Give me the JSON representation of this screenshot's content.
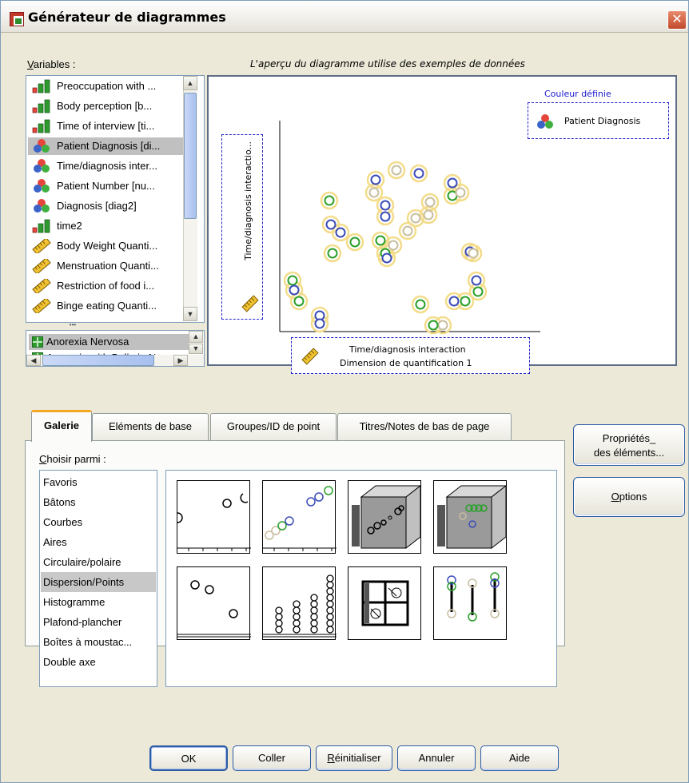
{
  "window": {
    "title": "Générateur de diagrammes",
    "close_glyph": "✕"
  },
  "variables": {
    "label": "Variables :",
    "items": [
      {
        "label": "Preoccupation with ...",
        "icon": "bar-ordinal-icon"
      },
      {
        "label": "Body perception [b...",
        "icon": "bar-ordinal-icon"
      },
      {
        "label": "Time of interview [ti...",
        "icon": "bar-ordinal-icon"
      },
      {
        "label": "Patient Diagnosis [di...",
        "icon": "nominal-icon",
        "selected": true
      },
      {
        "label": "Time/diagnosis inter...",
        "icon": "nominal-icon"
      },
      {
        "label": "Patient Number [nu...",
        "icon": "nominal-icon"
      },
      {
        "label": "Diagnosis [diag2]",
        "icon": "nominal-icon"
      },
      {
        "label": "time2",
        "icon": "bar-ordinal-icon"
      },
      {
        "label": "Body Weight Quanti...",
        "icon": "ruler-scale-icon"
      },
      {
        "label": "Menstruation Quanti...",
        "icon": "ruler-scale-icon"
      },
      {
        "label": "Restriction of food i...",
        "icon": "ruler-scale-icon"
      },
      {
        "label": "Binge eating Quanti...",
        "icon": "ruler-scale-icon"
      }
    ],
    "categories": [
      {
        "label": "Anorexia Nervosa",
        "selected": true
      },
      {
        "label": "Anorexia with Bulimia N..."
      }
    ]
  },
  "preview": {
    "caption": "L'aperçu du diagramme utilise des exemples de données",
    "legend_title": "Couleur définie",
    "legend_variable": "Patient Diagnosis",
    "y_axis_variable": "Time/diagnosis interactio...",
    "x_axis_line1": "Time/diagnosis interaction",
    "x_axis_line2": "Dimension de quantification 1",
    "colors": {
      "green": "#2aa02a",
      "blue": "#3b4cb8",
      "tan": "#c8bea0",
      "ring": "#f3dc8a"
    }
  },
  "tabs": [
    "Galerie",
    "Eléments de base",
    "Groupes/ID de point",
    "Titres/Notes de bas de page"
  ],
  "gallery": {
    "choose_label": "Choisir parmi :",
    "items": [
      "Favoris",
      "Bâtons",
      "Courbes",
      "Aires",
      "Circulaire/polaire",
      "Dispersion/Points",
      "Histogramme",
      "Plafond-plancher",
      "Boîtes à moustac...",
      "Double axe"
    ],
    "selected": "Dispersion/Points",
    "thumbnails": [
      "simple-scatter-icon",
      "grouped-scatter-icon",
      "simple-3d-scatter-icon",
      "grouped-3d-scatter-icon",
      "summary-point-plot-icon",
      "simple-dot-plot-icon",
      "scatterplot-matrix-icon",
      "drop-line-icon"
    ]
  },
  "side_buttons": {
    "properties_line1": "Propriétés_",
    "properties_line2": "des éléments...",
    "options": "Options"
  },
  "buttons": {
    "ok": "OK",
    "paste": "Coller",
    "reset": "Réinitialiser",
    "cancel": "Annuler",
    "help": "Aide"
  }
}
